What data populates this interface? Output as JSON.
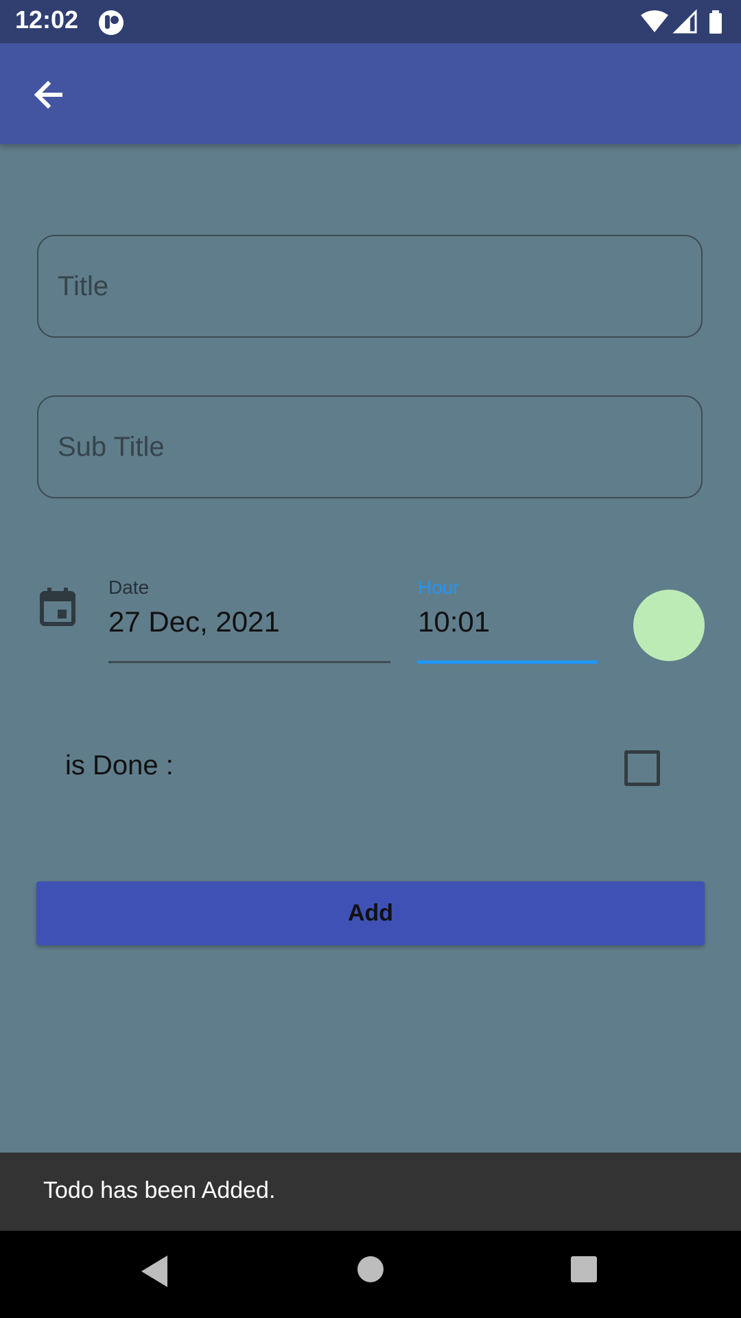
{
  "status_bar": {
    "time": "12:02"
  },
  "app_bar": {
    "back_icon": "arrow-back-icon"
  },
  "form": {
    "title": {
      "placeholder": "Title",
      "value": ""
    },
    "subtitle": {
      "placeholder": "Sub Title",
      "value": ""
    },
    "date": {
      "label": "Date",
      "value": "27 Dec, 2021"
    },
    "hour": {
      "label": "Hour",
      "value": "10:01",
      "focused": true
    },
    "is_done": {
      "label": "is Done :",
      "checked": false
    },
    "add_button": "Add"
  },
  "snackbar": {
    "message": "Todo has been Added."
  },
  "colors": {
    "background": "#607d8b",
    "app_bar": "#4355a1",
    "status_bar": "#303f70",
    "accent": "#2196f3",
    "button": "#3f51b5",
    "status_dot": "#bdebb6",
    "snackbar": "#333333"
  }
}
